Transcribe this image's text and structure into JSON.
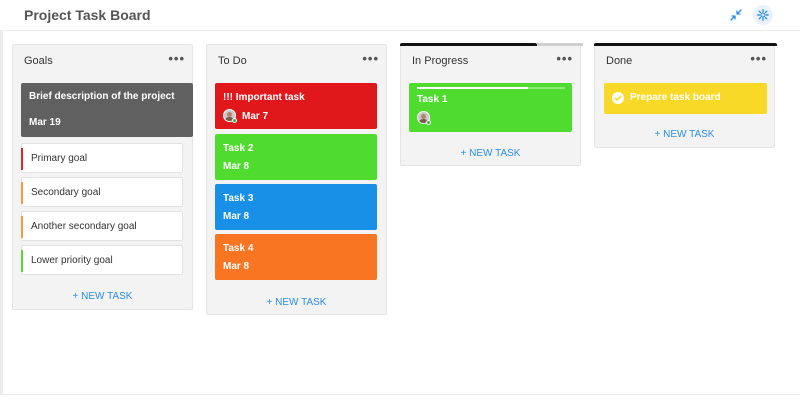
{
  "header": {
    "title": "Project Task Board",
    "collapse_icon": "collapse-arrows-icon",
    "settings_icon": "gear-icon",
    "accent": "#2b8ee8"
  },
  "columns": [
    {
      "title": "Goals",
      "menu": "•••",
      "new_task": "+ NEW TASK",
      "summary_card": {
        "title": "Brief description of the project",
        "date": "Mar 19",
        "color": "#606060"
      },
      "goals": [
        {
          "label": "Primary goal",
          "color": "#e0252b"
        },
        {
          "label": "Secondary goal",
          "color": "#f39c3c"
        },
        {
          "label": "Another secondary goal",
          "color": "#f39c3c"
        },
        {
          "label": "Lower priority goal",
          "color": "#5ad43c"
        }
      ]
    },
    {
      "title": "To Do",
      "menu": "•••",
      "new_task": "+ NEW TASK",
      "cards": [
        {
          "title": "!!! Important task",
          "date": "Mar 7",
          "color": "#e0181c",
          "has_avatar": true
        },
        {
          "title": "Task 2",
          "date": "Mar 8",
          "color": "#4fdc2f"
        },
        {
          "title": "Task 3",
          "date": "Mar 8",
          "color": "#1890e8"
        },
        {
          "title": "Task 4",
          "date": "Mar 8",
          "color": "#fa7522"
        }
      ]
    },
    {
      "title": "In Progress",
      "menu": "•••",
      "new_task": "+ NEW TASK",
      "progress": 0.74,
      "cards": [
        {
          "title": "Task 1",
          "color": "#4fdc2f",
          "has_avatar": true,
          "progress": 0.75
        }
      ]
    },
    {
      "title": "Done",
      "menu": "•••",
      "new_task": "+ NEW TASK",
      "cards": [
        {
          "title": "Prepare task board",
          "color": "#f8d927",
          "done": true,
          "check_icon": "check-circle-icon"
        }
      ]
    }
  ]
}
